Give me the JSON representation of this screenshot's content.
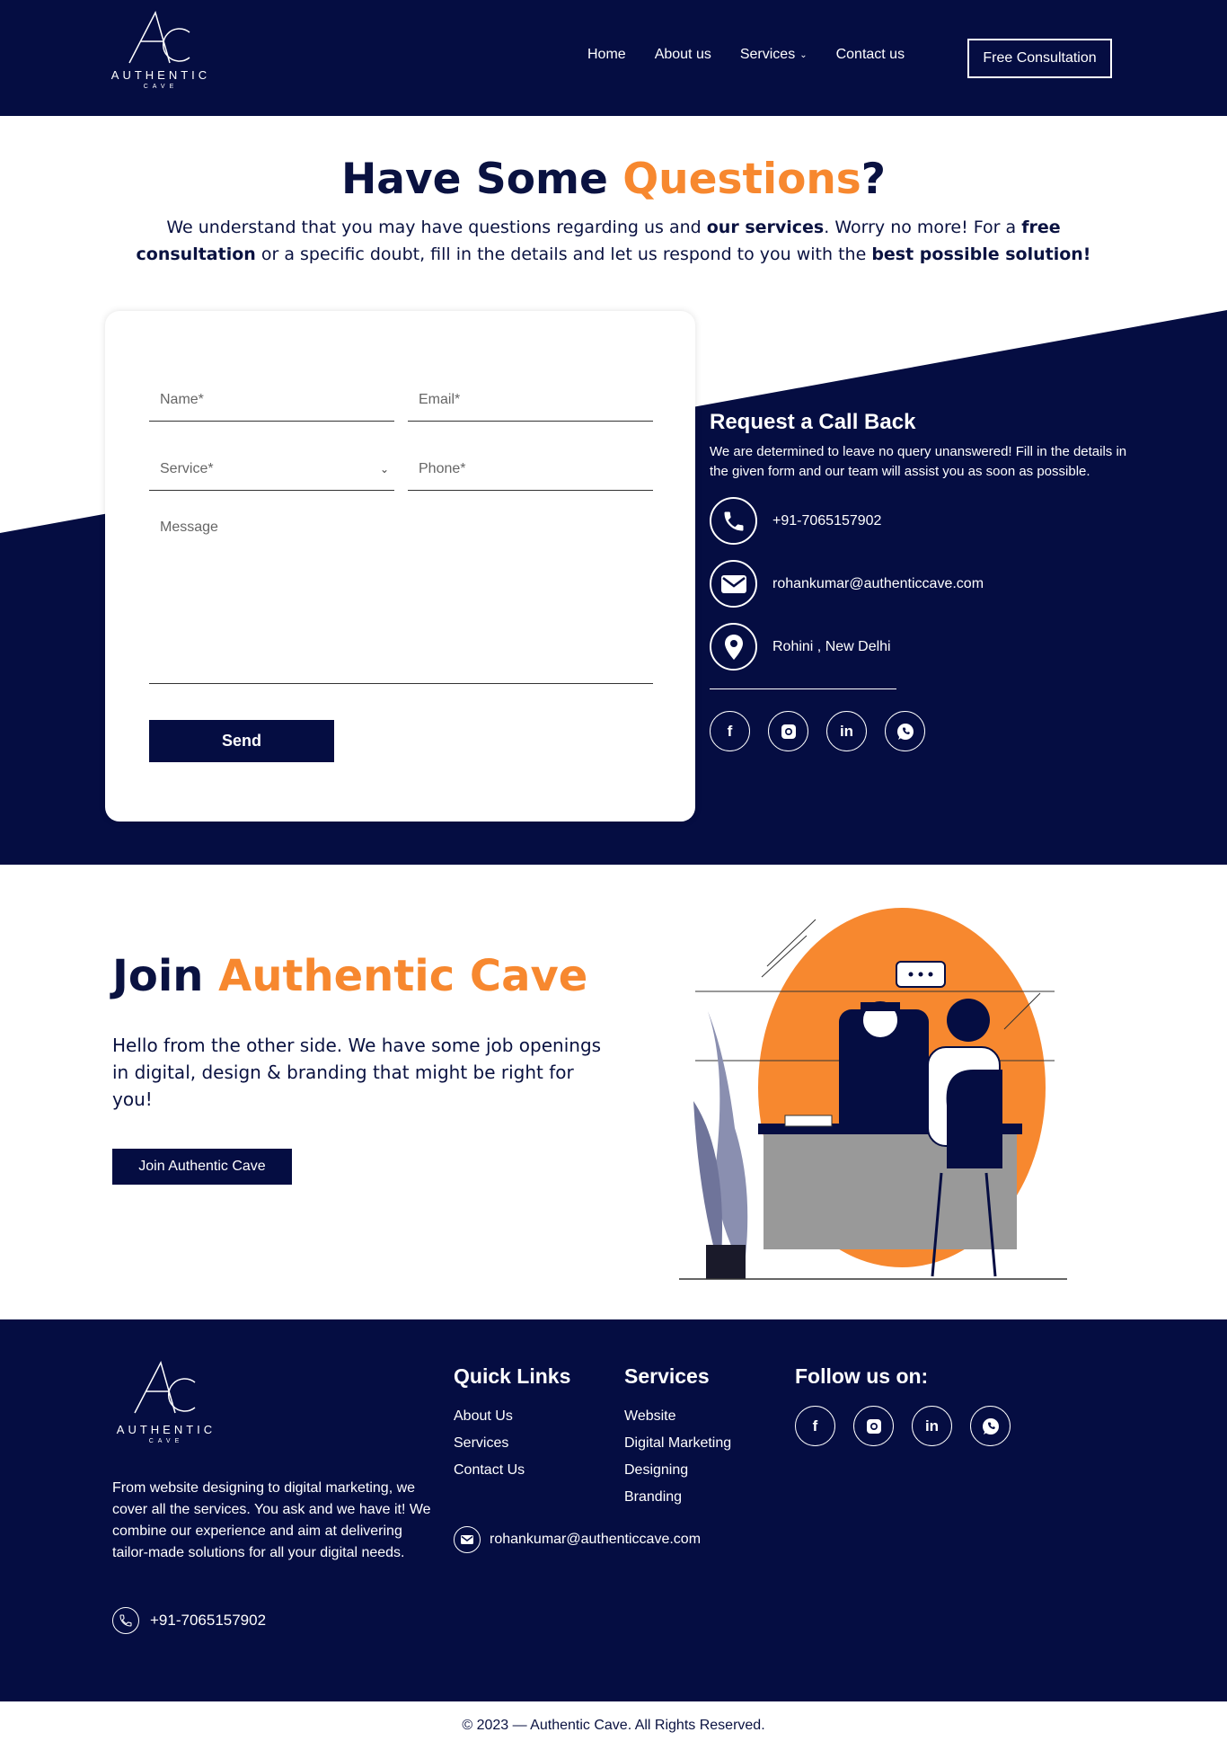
{
  "header": {
    "logo_word": "AUTHENTIC",
    "logo_sub": "CAVE",
    "nav": [
      "Home",
      "About us",
      "Services",
      "Contact us"
    ],
    "cta": "Free Consultation"
  },
  "questions": {
    "title_main": "Have Some ",
    "title_accent": "Questions",
    "title_end": "?",
    "intro_1": "We understand that you may have questions regarding us and ",
    "intro_b1": "our services",
    "intro_2": ". Worry no more! For a ",
    "intro_b2": "free consultation",
    "intro_3": " or a specific doubt, fill in the details and let us respond to you with the ",
    "intro_b3": "best possible solution!"
  },
  "form": {
    "name_placeholder": "Name*",
    "email_placeholder": "Email*",
    "service_placeholder": "Service*",
    "phone_placeholder": "Phone*",
    "message_placeholder": "Message",
    "send_label": "Send"
  },
  "callback": {
    "title": "Request a Call Back",
    "text": "We are determined to leave no query unanswered! Fill in the details in the given form and our team will assist you as soon as possible.",
    "phone": "+91-7065157902",
    "email": "rohankumar@authenticcave.com",
    "location": "Rohini , New Delhi",
    "socials": [
      "facebook-icon",
      "instagram-icon",
      "linkedin-icon",
      "whatsapp-icon"
    ]
  },
  "join": {
    "title_main": "Join ",
    "title_accent": "Authentic Cave",
    "text": "Hello from the other side. We have some job openings in digital, design & branding that might be right for you!",
    "button": "Join Authentic Cave"
  },
  "footer": {
    "about": "From website designing to digital marketing, we cover all the services. You ask and we have it! We combine our experience and aim at delivering tailor-made solutions for all your digital needs.",
    "phone": "+91-7065157902",
    "quick_links_title": "Quick Links",
    "quick_links": [
      "About Us",
      "Services",
      "Contact Us"
    ],
    "services_title": "Services",
    "services": [
      "Website",
      "Digital Marketing",
      "Designing",
      "Branding"
    ],
    "email": "rohankumar@authenticcave.com",
    "follow_title": "Follow us on:",
    "copyright": "© 2023 — Authentic Cave. All Rights Reserved."
  },
  "colors": {
    "navy": "#050d42",
    "orange": "#f7882f"
  }
}
